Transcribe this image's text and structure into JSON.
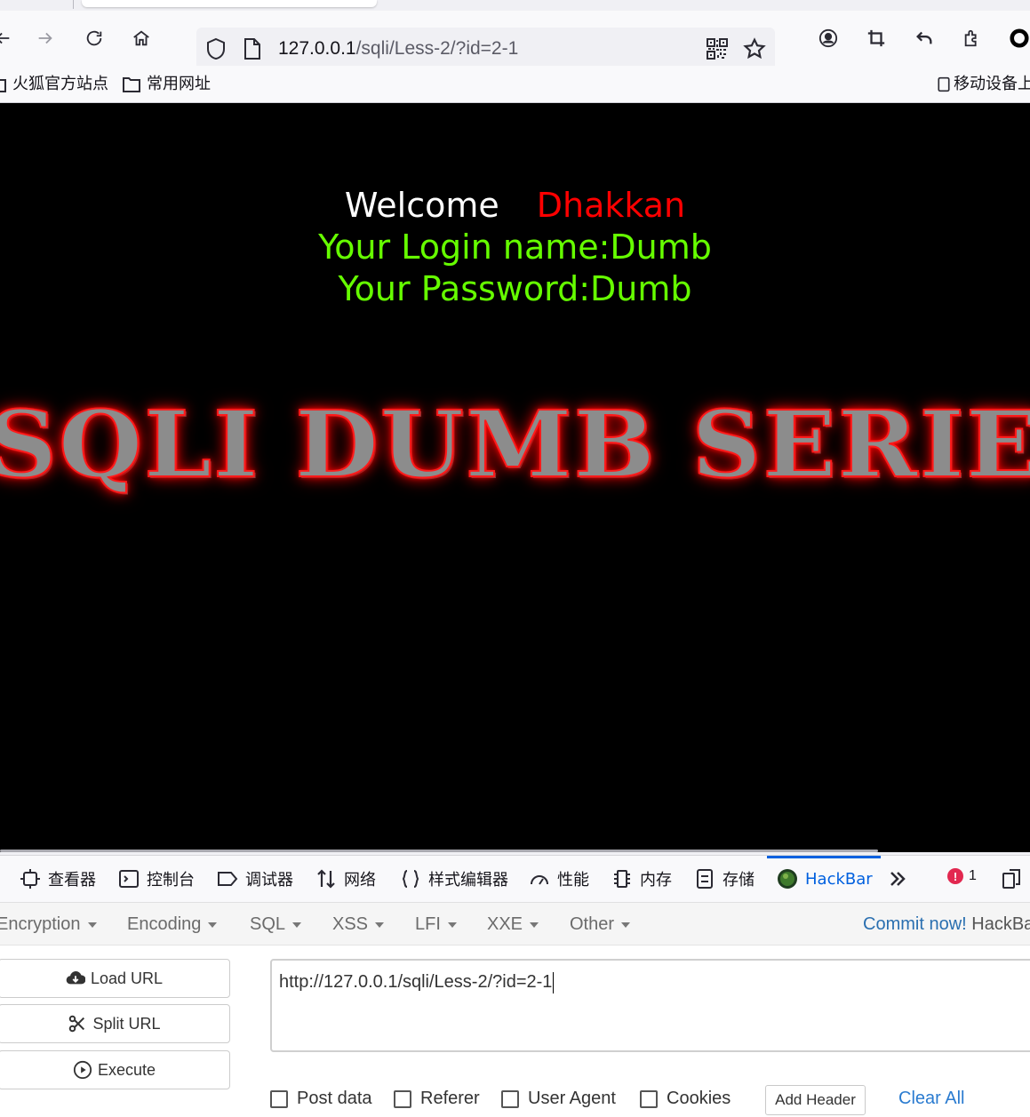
{
  "browser": {
    "url_host": "127.0.0.1",
    "url_path": "/sqli/Less-2/?id=2-1",
    "bookmarks": [
      {
        "label": "火狐官方站点"
      },
      {
        "label": "常用网址"
      }
    ],
    "mobile_bookmarks_label": "移动设备上"
  },
  "page": {
    "welcome_label": "Welcome",
    "welcome_name": "Dhakkan",
    "login_line": "Your Login name:Dumb",
    "password_line": "Your Password:Dumb",
    "banner_text": "SQLI DUMB SERIES",
    "colors": {
      "background": "#000000",
      "welcome": "#ffffff",
      "name": "#ff0000",
      "credentials": "#66ff00"
    }
  },
  "devtools": {
    "tabs": [
      {
        "label": "查看器",
        "icon": "inspector-icon"
      },
      {
        "label": "控制台",
        "icon": "console-icon"
      },
      {
        "label": "调试器",
        "icon": "debugger-icon"
      },
      {
        "label": "网络",
        "icon": "network-icon"
      },
      {
        "label": "样式编辑器",
        "icon": "style-editor-icon"
      },
      {
        "label": "性能",
        "icon": "performance-icon"
      },
      {
        "label": "内存",
        "icon": "memory-icon"
      },
      {
        "label": "存储",
        "icon": "storage-icon"
      },
      {
        "label": "HackBar",
        "icon": "hackbar-icon"
      }
    ],
    "active_tab": "HackBar",
    "error_count": "1"
  },
  "hackbar": {
    "menu": [
      {
        "label": "Encryption"
      },
      {
        "label": "Encoding"
      },
      {
        "label": "SQL"
      },
      {
        "label": "XSS"
      },
      {
        "label": "LFI"
      },
      {
        "label": "XXE"
      },
      {
        "label": "Other"
      }
    ],
    "commit_link": "Commit now!",
    "commit_rest": "HackBar",
    "buttons": {
      "load_url": "Load URL",
      "split_url": "Split URL",
      "execute": "Execute"
    },
    "url_value": "http://127.0.0.1/sqli/Less-2/?id=2-1",
    "checkboxes": [
      {
        "label": "Post data"
      },
      {
        "label": "Referer"
      },
      {
        "label": "User Agent"
      },
      {
        "label": "Cookies"
      }
    ],
    "add_header": "Add Header",
    "clear_all": "Clear All"
  }
}
